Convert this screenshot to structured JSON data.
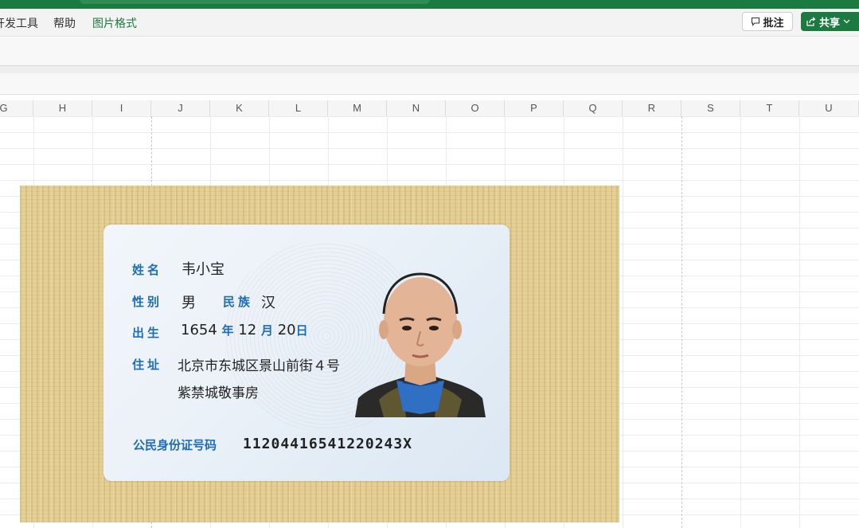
{
  "ribbon_tabs": [
    {
      "label": "开发工具",
      "active": false
    },
    {
      "label": "帮助",
      "active": false
    },
    {
      "label": "图片格式",
      "active": true
    }
  ],
  "actions": {
    "comment_label": "批注",
    "share_label": "共享"
  },
  "columns": [
    "G",
    "H",
    "I",
    "J",
    "K",
    "L",
    "M",
    "N",
    "O",
    "P",
    "Q",
    "R",
    "S",
    "T",
    "U"
  ],
  "id_card": {
    "name_label": "姓名",
    "name": "韦小宝",
    "sex_label": "性别",
    "sex": "男",
    "ethnicity_label": "民族",
    "ethnicity": "汉",
    "birth_label": "出生",
    "birth_year": "1654",
    "birth_year_unit": "年",
    "birth_month": "12",
    "birth_month_unit": "月",
    "birth_day": "20",
    "birth_day_unit": "日",
    "address_label": "住址",
    "address_line1": "北京市东城区景山前街４号",
    "address_line2": "紫禁城敬事房",
    "id_number_label": "公民身份证号码",
    "id_number": "11204416541220243X"
  },
  "colors": {
    "accent": "#1b7a3f",
    "card_label": "#1e6db5"
  }
}
